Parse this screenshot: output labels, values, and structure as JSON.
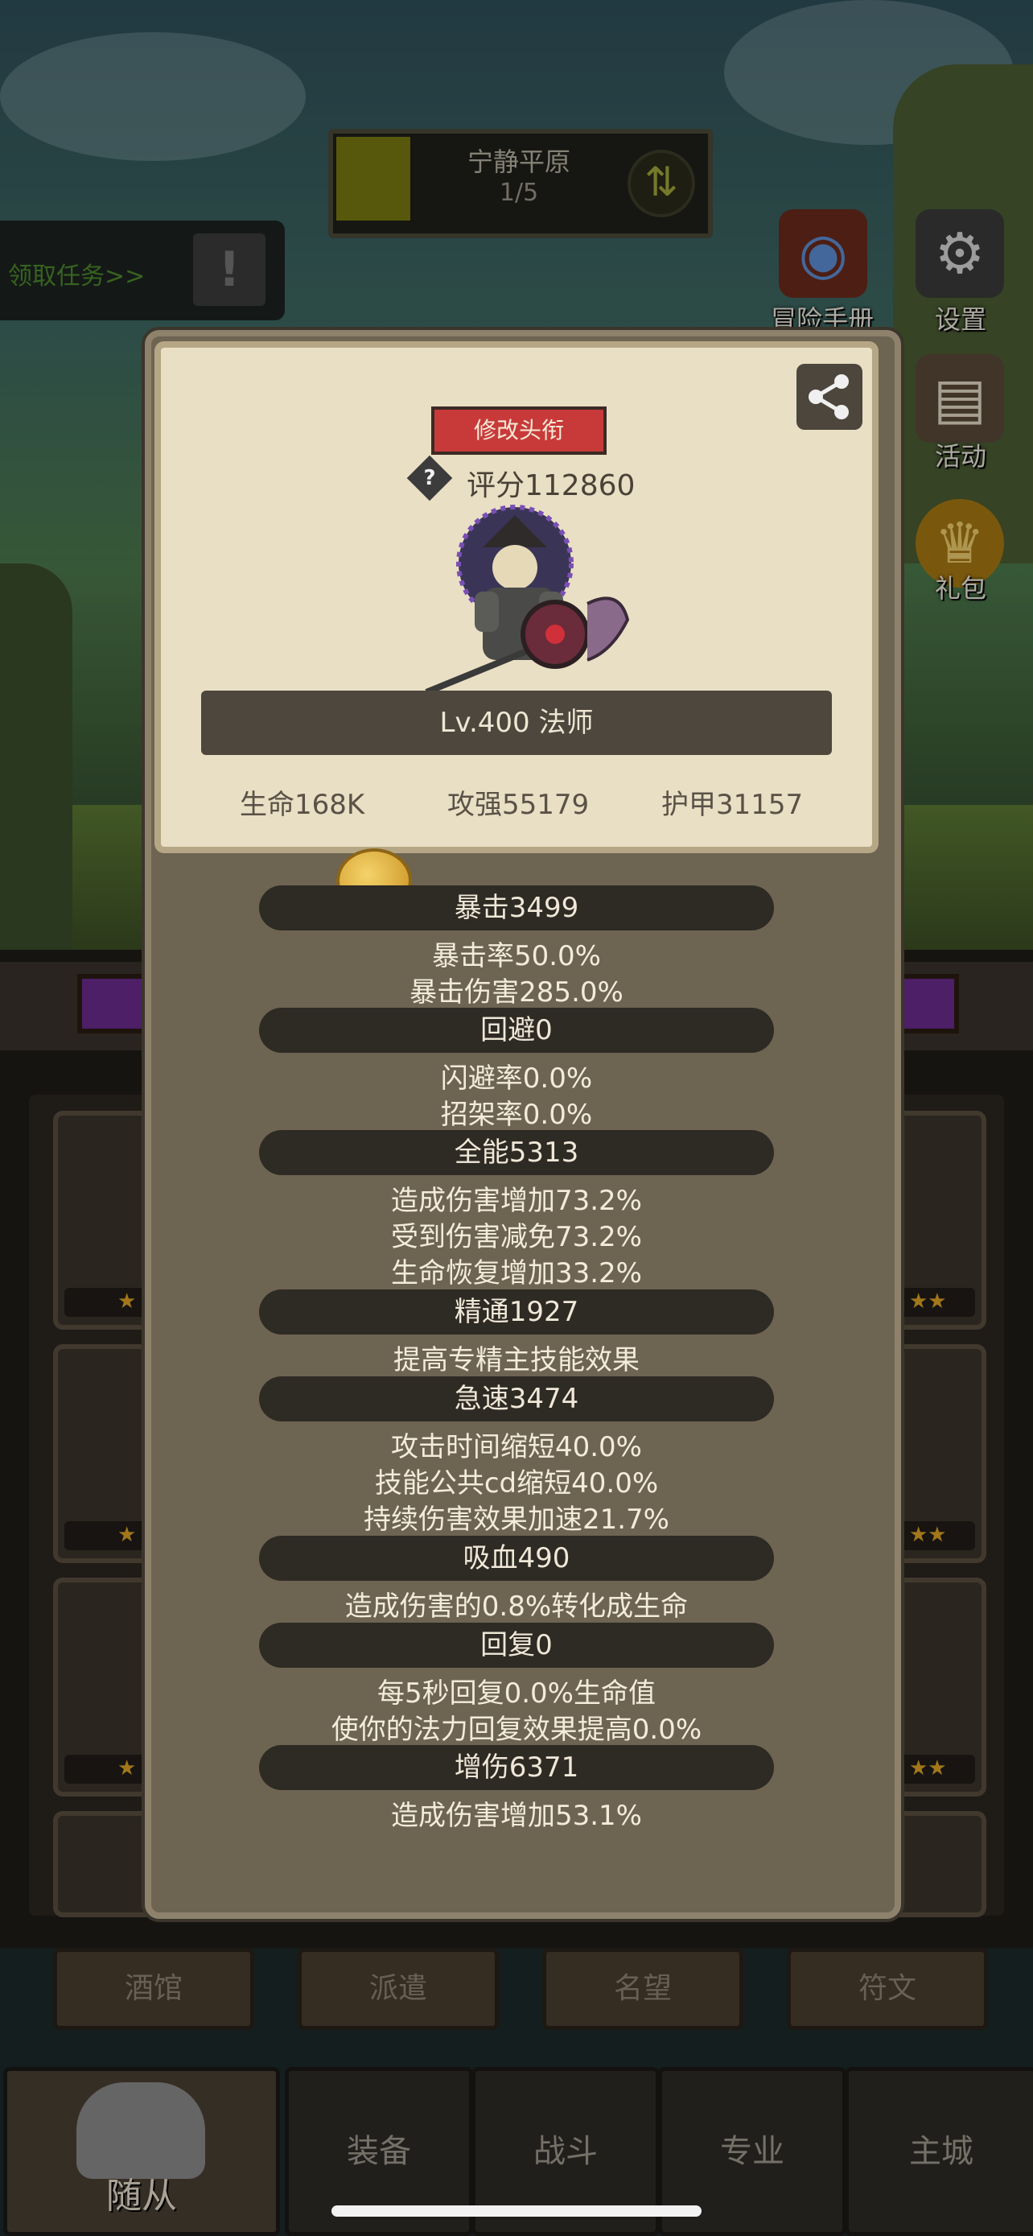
{
  "stage": {
    "title": "宁静平原",
    "progress": "1/5"
  },
  "quest": {
    "label": "领取任务>>"
  },
  "side_menu": [
    {
      "label": "冒险手册",
      "icon": "book-icon"
    },
    {
      "label": "设置",
      "icon": "gear-icon"
    },
    {
      "label": "活动",
      "icon": "notice-icon"
    },
    {
      "label": "礼包",
      "icon": "gift-icon"
    }
  ],
  "card": {
    "edit_title": "修改头衔",
    "score": "评分112860",
    "level_class": "Lv.400 法师",
    "hp": "生命168K",
    "attack": "攻强55179",
    "armor": "护甲31157"
  },
  "stats": [
    {
      "title": "暴击3499",
      "lines": [
        "暴击率50.0%",
        "暴击伤害285.0%"
      ]
    },
    {
      "title": "回避0",
      "lines": [
        "闪避率0.0%",
        "招架率0.0%"
      ]
    },
    {
      "title": "全能5313",
      "lines": [
        "造成伤害增加73.2%",
        "受到伤害减免73.2%",
        "生命恢复增加33.2%"
      ]
    },
    {
      "title": "精通1927",
      "lines": [
        "提高专精主技能效果"
      ]
    },
    {
      "title": "急速3474",
      "lines": [
        "攻击时间缩短40.0%",
        "技能公共cd缩短40.0%",
        "持续伤害效果加速21.7%"
      ]
    },
    {
      "title": "吸血490",
      "lines": [
        "造成伤害的0.8%转化成生命"
      ]
    },
    {
      "title": "回复0",
      "lines": [
        "每5秒回复0.0%生命值",
        "使你的法力回复效果提高0.0%"
      ]
    },
    {
      "title": "增伤6371",
      "lines": [
        "造成伤害增加53.1%"
      ]
    }
  ],
  "sub_tabs": [
    "酒馆",
    "派遣",
    "名望",
    "符文"
  ],
  "nav_tabs": [
    "随从",
    "装备",
    "战斗",
    "专业",
    "主城"
  ]
}
